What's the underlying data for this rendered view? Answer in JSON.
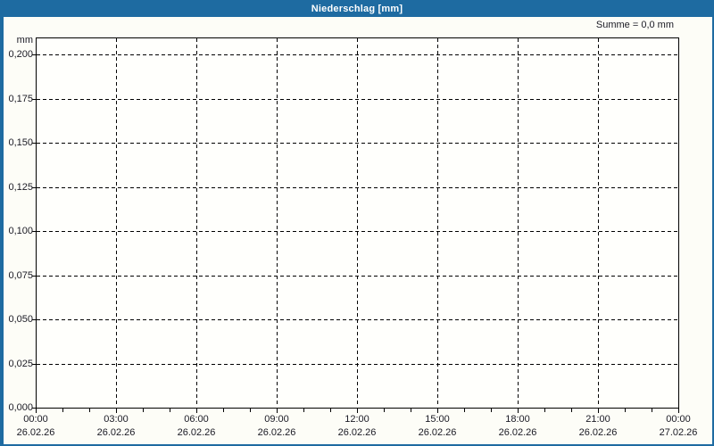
{
  "window": {
    "title": "Niederschlag [mm]"
  },
  "colors": {
    "titlebar": "#1e6ba1",
    "border": "#1e6ba1",
    "title_text": "#ffffff",
    "background": "#fdfdf7",
    "plot_background": "#fffffc",
    "grid": "#000000",
    "text": "#1a1a24"
  },
  "chart_data": {
    "type": "bar",
    "title": "Niederschlag [mm]",
    "ylabel": "mm",
    "xlabel": "",
    "annotation": "Summe = 0,0 mm",
    "grid": "dashed",
    "legend": "none",
    "ylim": [
      0,
      0.21
    ],
    "y_ticks": [
      {
        "label": "0,000",
        "value": 0.0
      },
      {
        "label": "0,025",
        "value": 0.025
      },
      {
        "label": "0,050",
        "value": 0.05
      },
      {
        "label": "0,075",
        "value": 0.075
      },
      {
        "label": "0,100",
        "value": 0.1
      },
      {
        "label": "0,125",
        "value": 0.125
      },
      {
        "label": "0,150",
        "value": 0.15
      },
      {
        "label": "0,175",
        "value": 0.175
      },
      {
        "label": "0,200",
        "value": 0.2
      }
    ],
    "x_range_hours": 24,
    "x_major_tick_hours": 3,
    "x_minor_tick_hours": 1,
    "x_ticks": [
      {
        "time": "00:00",
        "date": "26.02.26",
        "hour": 0
      },
      {
        "time": "03:00",
        "date": "26.02.26",
        "hour": 3
      },
      {
        "time": "06:00",
        "date": "26.02.26",
        "hour": 6
      },
      {
        "time": "09:00",
        "date": "26.02.26",
        "hour": 9
      },
      {
        "time": "12:00",
        "date": "26.02.26",
        "hour": 12
      },
      {
        "time": "15:00",
        "date": "26.02.26",
        "hour": 15
      },
      {
        "time": "18:00",
        "date": "26.02.26",
        "hour": 18
      },
      {
        "time": "21:00",
        "date": "26.02.26",
        "hour": 21
      },
      {
        "time": "00:00",
        "date": "27.02.26",
        "hour": 24
      }
    ],
    "series": []
  }
}
